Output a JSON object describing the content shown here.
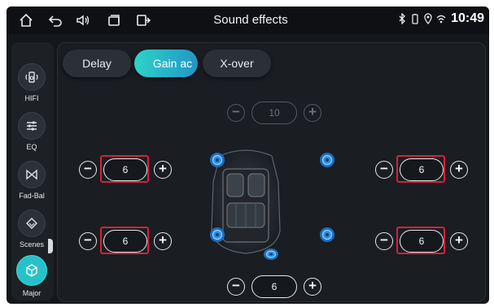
{
  "status_bar": {
    "title": "Sound effects",
    "time": "10:49",
    "icons": [
      "home-icon",
      "back-icon",
      "volume-icon",
      "recent-apps-icon",
      "split-screen-icon",
      "bluetooth-icon",
      "battery-icon",
      "location-icon",
      "wifi-icon"
    ]
  },
  "sidebar": {
    "items": [
      {
        "label": "HIFI",
        "icon": "hifi-speaker-icon"
      },
      {
        "label": "EQ",
        "icon": "equalizer-icon"
      },
      {
        "label": "Fad-Bal",
        "icon": "fader-balance-icon"
      },
      {
        "label": "Scenes",
        "icon": "scenes-icon"
      },
      {
        "label": "Major",
        "icon": "cube-icon",
        "active": true
      }
    ]
  },
  "tabs": [
    {
      "label": "Delay"
    },
    {
      "label": "Gain ac",
      "active": true
    },
    {
      "label": "X-over"
    }
  ],
  "gain": {
    "master": "10",
    "front_left": "6",
    "front_right": "6",
    "rear_left": "6",
    "rear_right": "6",
    "subwoofer": "6"
  },
  "controls": {
    "minus": "−",
    "plus": "+"
  },
  "colors": {
    "accent": "#27c2c9",
    "highlight": "#d4223a",
    "speaker": "#2a8fe8"
  }
}
